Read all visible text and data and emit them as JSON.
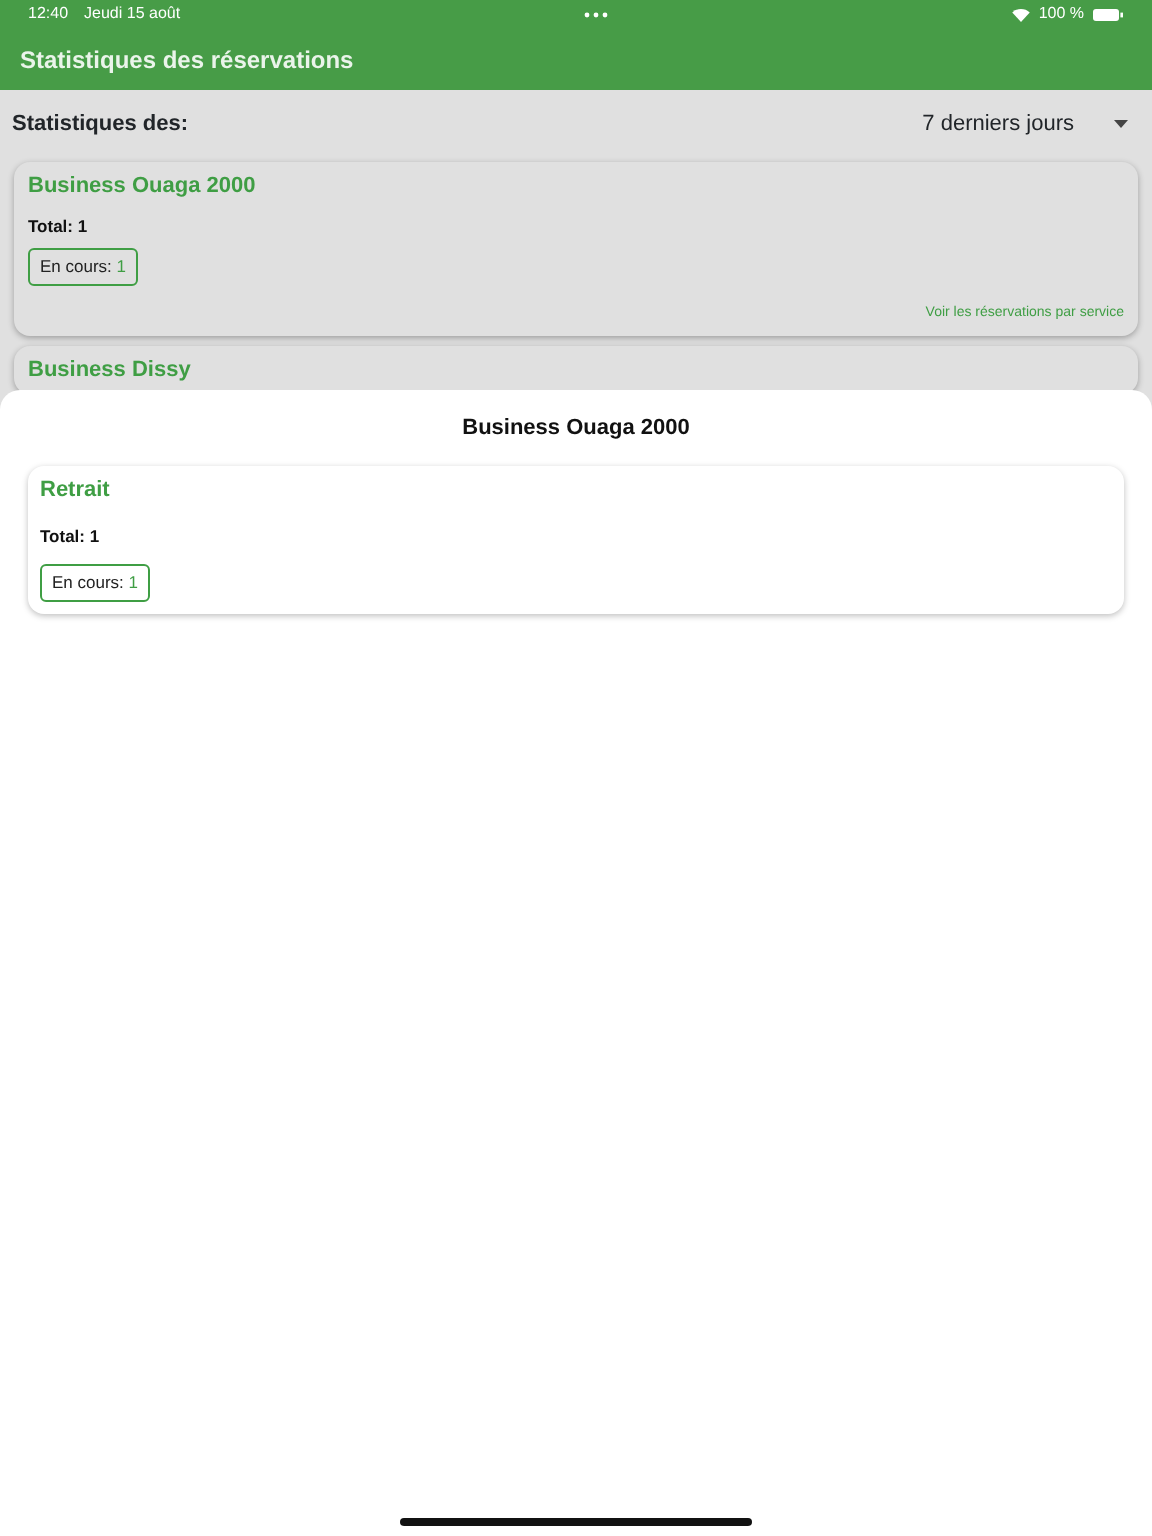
{
  "status_bar": {
    "time": "12:40",
    "date": "Jeudi 15 août",
    "battery": "100 %"
  },
  "header": {
    "title": "Statistiques des réservations"
  },
  "filter": {
    "label": "Statistiques des:",
    "value": "7 derniers jours"
  },
  "cards": [
    {
      "title": "Business Ouaga 2000",
      "total": "Total: 1",
      "chips": [
        {
          "label": "En cours:",
          "count": "1"
        }
      ],
      "link": "Voir les réservations par service"
    },
    {
      "title": "Business Dissy"
    }
  ],
  "sheet": {
    "title": "Business Ouaga 2000",
    "cards": [
      {
        "title": "Retrait",
        "total": "Total: 1",
        "chips": [
          {
            "label": "En cours:",
            "count": "1"
          }
        ]
      }
    ]
  }
}
